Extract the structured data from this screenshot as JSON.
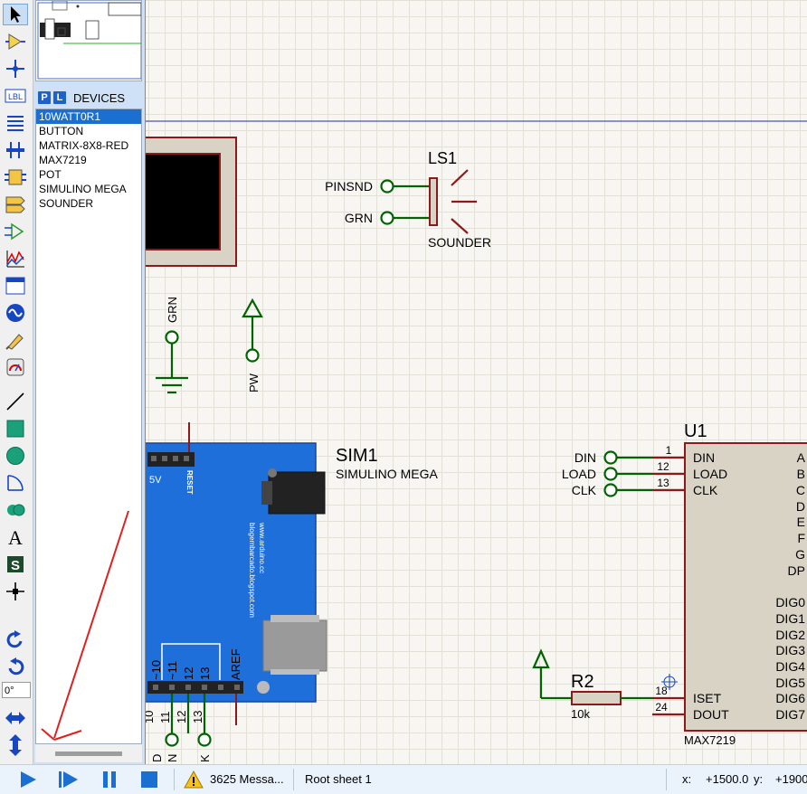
{
  "devices": {
    "header_p": "P",
    "header_l": "L",
    "title": "DEVICES",
    "items": [
      "10WATT0R1",
      "BUTTON",
      "MATRIX-8X8-RED",
      "MAX7219",
      "POT",
      "SIMULINO MEGA",
      "SOUNDER"
    ],
    "selected_index": 0
  },
  "toolbar": {
    "angle_value": "0°",
    "tools": [
      "selection-mode-icon",
      "component-mode-icon",
      "junction-dot-icon",
      "wire-label-icon",
      "text-script-icon",
      "bus-icon",
      "subcircuit-icon",
      "terminals-icon",
      "device-pins-icon",
      "graph-icon",
      "tape-recorder-icon",
      "generator-icon",
      "voltage-probe-icon",
      "virtual-instruments-icon",
      "line-2d-icon",
      "box-2d-icon",
      "circle-2d-icon",
      "arc-2d-icon",
      "path-2d-icon",
      "text-2d-icon",
      "symbol-2d-icon",
      "marker-2d-icon",
      "rotate-clockwise-icon",
      "rotate-anticlockwise-icon",
      "mirror-horizontal-icon",
      "mirror-vertical-icon"
    ]
  },
  "schematic": {
    "ls1": {
      "ref": "LS1",
      "type": "SOUNDER",
      "pin1": "PINSND",
      "pin2": "GRN"
    },
    "grn_terminal": "GRN",
    "pw_terminal": "PW",
    "sim1": {
      "ref": "SIM1",
      "type": "SIMULINO MEGA",
      "header_5v": "5V",
      "reset": "RESET",
      "aref": "AREF",
      "url1": "www.arduino.cc",
      "url2": "blogembarcado.blogspot.com",
      "pins_top": [
        "~10",
        "~11",
        "12",
        "13"
      ],
      "pins_below": [
        "10",
        "11",
        "12",
        "13"
      ],
      "term_labels": [
        "D",
        "N",
        "K"
      ]
    },
    "u1": {
      "ref": "U1",
      "type": "MAX7219",
      "inputs": [
        {
          "net": "DIN",
          "num": "1",
          "name": "DIN"
        },
        {
          "net": "LOAD",
          "num": "12",
          "name": "LOAD"
        },
        {
          "net": "CLK",
          "num": "13",
          "name": "CLK"
        }
      ],
      "lower_pins": [
        {
          "num": "18",
          "name": "ISET"
        },
        {
          "num": "24",
          "name": "DOUT"
        }
      ],
      "right_pins": [
        "A",
        "B",
        "C",
        "D",
        "E",
        "F",
        "G",
        "DP",
        "DIG0",
        "DIG1",
        "DIG2",
        "DIG3",
        "DIG4",
        "DIG5",
        "DIG6",
        "DIG7"
      ]
    },
    "r2": {
      "ref": "R2",
      "value": "10k"
    }
  },
  "status": {
    "messages": "3625 Messa...",
    "sheet": "Root sheet 1",
    "x_label": "x:",
    "x_value": "+1500.0",
    "y_label": "y:",
    "y_value": "+1900"
  },
  "colors": {
    "wire": "#006400",
    "component": "#8b1a1a",
    "accent": "#1b6fd0",
    "arduino": "#1e6fd9"
  }
}
